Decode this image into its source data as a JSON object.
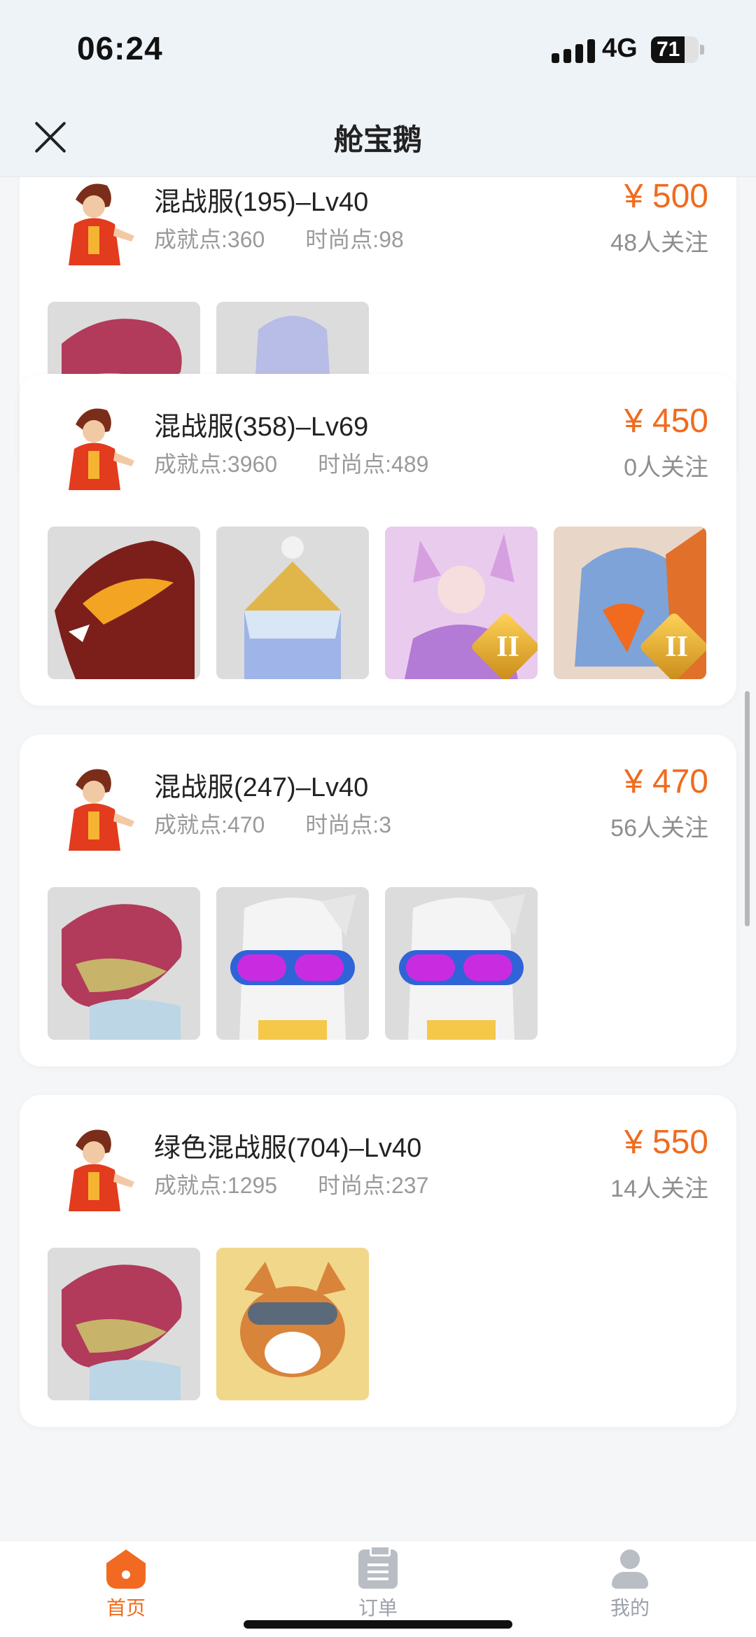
{
  "status_bar": {
    "time": "06:24",
    "network": "4G",
    "battery": "71",
    "battery_level": 0.71
  },
  "header": {
    "title": "舱宝鹅",
    "close_icon": "close-icon"
  },
  "listings": [
    {
      "name": "混战服(195)–Lv40",
      "achievement": "成就点:360",
      "fashion": "时尚点:98",
      "price": "¥ 500",
      "followers": "48人关注",
      "items": [
        {
          "icon": "dragon-skin",
          "rank": ""
        },
        {
          "icon": "ultraman-skin",
          "rank": ""
        }
      ]
    },
    {
      "name": "混战服(358)–Lv69",
      "achievement": "成就点:3960",
      "fashion": "时尚点:489",
      "price": "¥ 450",
      "followers": "0人关注",
      "items": [
        {
          "icon": "fire-dragon-skin",
          "rank": ""
        },
        {
          "icon": "golden-crown-skin",
          "rank": ""
        },
        {
          "icon": "fox-girl-skin",
          "rank": "II"
        },
        {
          "icon": "eagle-skin",
          "rank": "II"
        }
      ]
    },
    {
      "name": "混战服(247)–Lv40",
      "achievement": "成就点:470",
      "fashion": "时尚点:3",
      "price": "¥ 470",
      "followers": "56人关注",
      "items": [
        {
          "icon": "dragon-skin",
          "rank": ""
        },
        {
          "icon": "goggle-dog-skin",
          "rank": ""
        },
        {
          "icon": "goggle-dog-skin",
          "rank": ""
        }
      ]
    },
    {
      "name": "绿色混战服(704)–Lv40",
      "achievement": "成就点:1295",
      "fashion": "时尚点:237",
      "price": "¥ 550",
      "followers": "14人关注",
      "items": [
        {
          "icon": "dragon-skin",
          "rank": ""
        },
        {
          "icon": "corgi-pilot-skin",
          "rank": ""
        }
      ]
    }
  ],
  "tabbar": {
    "home": "首页",
    "orders": "订单",
    "mine": "我的"
  },
  "colors": {
    "accent": "#f06b1e",
    "header_bg": "#edf3f7"
  }
}
